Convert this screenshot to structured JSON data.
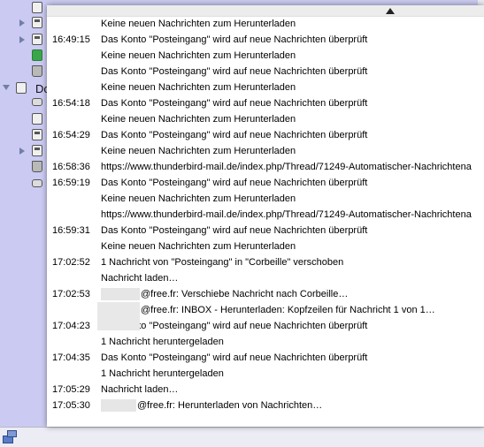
{
  "sidebar": {
    "folder_label": "Do"
  },
  "popup": {
    "rows": [
      {
        "time": "",
        "msg": "Keine neuen Nachrichten zum Herunterladen"
      },
      {
        "time": "16:49:15",
        "msg": "Das Konto \"Posteingang\" wird auf neue Nachrichten überprüft"
      },
      {
        "time": "",
        "msg": "Keine neuen Nachrichten zum Herunterladen"
      },
      {
        "time": "",
        "msg": "Das Konto \"Posteingang\" wird auf neue Nachrichten überprüft"
      },
      {
        "time": "",
        "msg": "Keine neuen Nachrichten zum Herunterladen"
      },
      {
        "time": "16:54:18",
        "msg": "Das Konto \"Posteingang\" wird auf neue Nachrichten überprüft"
      },
      {
        "time": "",
        "msg": "Keine neuen Nachrichten zum Herunterladen"
      },
      {
        "time": "16:54:29",
        "msg": "Das Konto \"Posteingang\" wird auf neue Nachrichten überprüft"
      },
      {
        "time": "",
        "msg": "Keine neuen Nachrichten zum Herunterladen"
      },
      {
        "time": "16:58:36",
        "msg": "https://www.thunderbird-mail.de/index.php/Thread/71249-Automatischer-Nachrichtena"
      },
      {
        "time": "16:59:19",
        "msg": "Das Konto \"Posteingang\" wird auf neue Nachrichten überprüft"
      },
      {
        "time": "",
        "msg": "Keine neuen Nachrichten zum Herunterladen"
      },
      {
        "time": "",
        "msg": "https://www.thunderbird-mail.de/index.php/Thread/71249-Automatischer-Nachrichtena"
      },
      {
        "time": "16:59:31",
        "msg": "Das Konto \"Posteingang\" wird auf neue Nachrichten überprüft"
      },
      {
        "time": "",
        "msg": "Keine neuen Nachrichten zum Herunterladen"
      },
      {
        "time": "17:02:52",
        "msg": "1 Nachricht von \"Posteingang\" in \"Corbeille\" verschoben"
      },
      {
        "time": "",
        "msg": "Nachricht laden…"
      },
      {
        "time": "17:02:53",
        "msg": "@free.fr: Verschiebe Nachricht nach Corbeille…",
        "redact": 44
      },
      {
        "time": "",
        "msg": "@free.fr: INBOX - Herunterladen: Kopfzeilen für Nachricht 1 von 1…",
        "redact": 44
      },
      {
        "time": "17:04:23",
        "msg": "Das Konto \"Posteingang\" wird auf neue Nachrichten überprüft"
      },
      {
        "time": "",
        "msg": "1 Nachricht heruntergeladen"
      },
      {
        "time": "17:04:35",
        "msg": "Das Konto \"Posteingang\" wird auf neue Nachrichten überprüft"
      },
      {
        "time": "",
        "msg": "1 Nachricht heruntergeladen"
      },
      {
        "time": "17:05:29",
        "msg": "Nachricht laden…"
      },
      {
        "time": "17:05:30",
        "msg": "@free.fr: Herunterladen von Nachrichten…",
        "redact": 40
      }
    ]
  }
}
